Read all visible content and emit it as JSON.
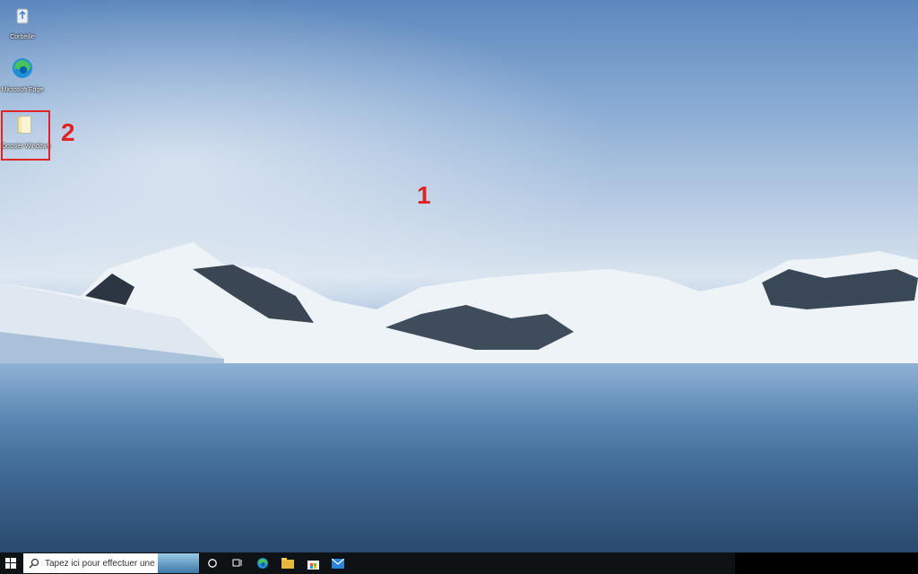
{
  "desktop": {
    "icons": [
      {
        "label": "Corbeille",
        "icon": "recycle-bin-icon"
      },
      {
        "label": "Microsoft Edge",
        "icon": "edge-icon"
      },
      {
        "label": "Dossier Windows",
        "icon": "folder-icon"
      }
    ],
    "callouts": [
      "1",
      "2"
    ]
  },
  "taskbar": {
    "start_icon": "windows-start-icon",
    "search_placeholder": "Tapez ici pour effectuer une",
    "buttons": [
      "cortana-icon",
      "task-view-icon",
      "edge-icon",
      "file-explorer-icon",
      "store-icon",
      "mail-icon"
    ]
  },
  "colors": {
    "annotation": "#e02424",
    "taskbar": "#0f1214"
  }
}
